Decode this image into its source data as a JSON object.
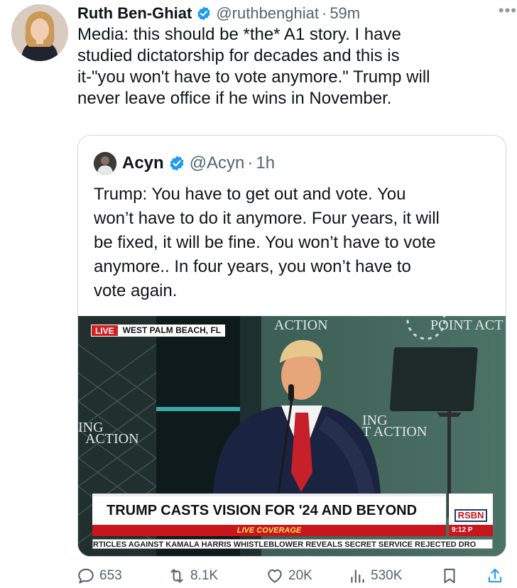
{
  "tweet": {
    "author": {
      "name": "Ruth Ben-Ghiat",
      "handle": "@ruthbenghiat",
      "time": "59m",
      "verified": true
    },
    "more_icon": "more-horizontal-icon",
    "text_lines": [
      "Media: this should be *the* A1 story.  I have",
      "studied dictatorship for decades and this is",
      "it-\"you won't have to vote anymore.\" Trump will",
      "never leave office if he wins in November."
    ]
  },
  "quote": {
    "author": {
      "name": "Acyn",
      "handle": "@Acyn",
      "time": "1h",
      "verified": true
    },
    "text_lines": [
      "Trump: You have to get out and vote. You",
      "won’t have to do it anymore. Four years, it will",
      "be fixed, it will be fine. You won’t have to vote",
      "anymore.. In four years, you won’t have to",
      "vote again."
    ],
    "video": {
      "live_label": "LIVE",
      "location": "WEST PALM BEACH, FL",
      "headline": "TRUMP CASTS VISION FOR '24 AND BEYOND",
      "subbar": "LIVE COVERAGE",
      "network": "RSBN",
      "clock": "9:12 P",
      "ticker": "RTICLES AGAINST KAMALA HARRIS   WHISTLEBLOWER REVEALS SECRET SERVICE REJECTED DRO",
      "set_text": {
        "top_center": "ACTION",
        "top_right": "POINT ACT",
        "left_line1": "ING",
        "left_line2": "ACTION",
        "right_line1": "ING",
        "right_line2": "T ACTION"
      }
    }
  },
  "actions": {
    "reply": {
      "icon": "reply-icon",
      "count": "653"
    },
    "retweet": {
      "icon": "retweet-icon",
      "count": "8.1K"
    },
    "like": {
      "icon": "heart-icon",
      "count": "20K"
    },
    "views": {
      "icon": "views-icon",
      "count": "530K"
    },
    "bookmark": {
      "icon": "bookmark-icon"
    },
    "share": {
      "icon": "share-icon"
    }
  },
  "colors": {
    "verified": "#1d9bf0",
    "secondary_text": "#536471",
    "border": "#cfd9de",
    "news_red": "#c8161d"
  }
}
